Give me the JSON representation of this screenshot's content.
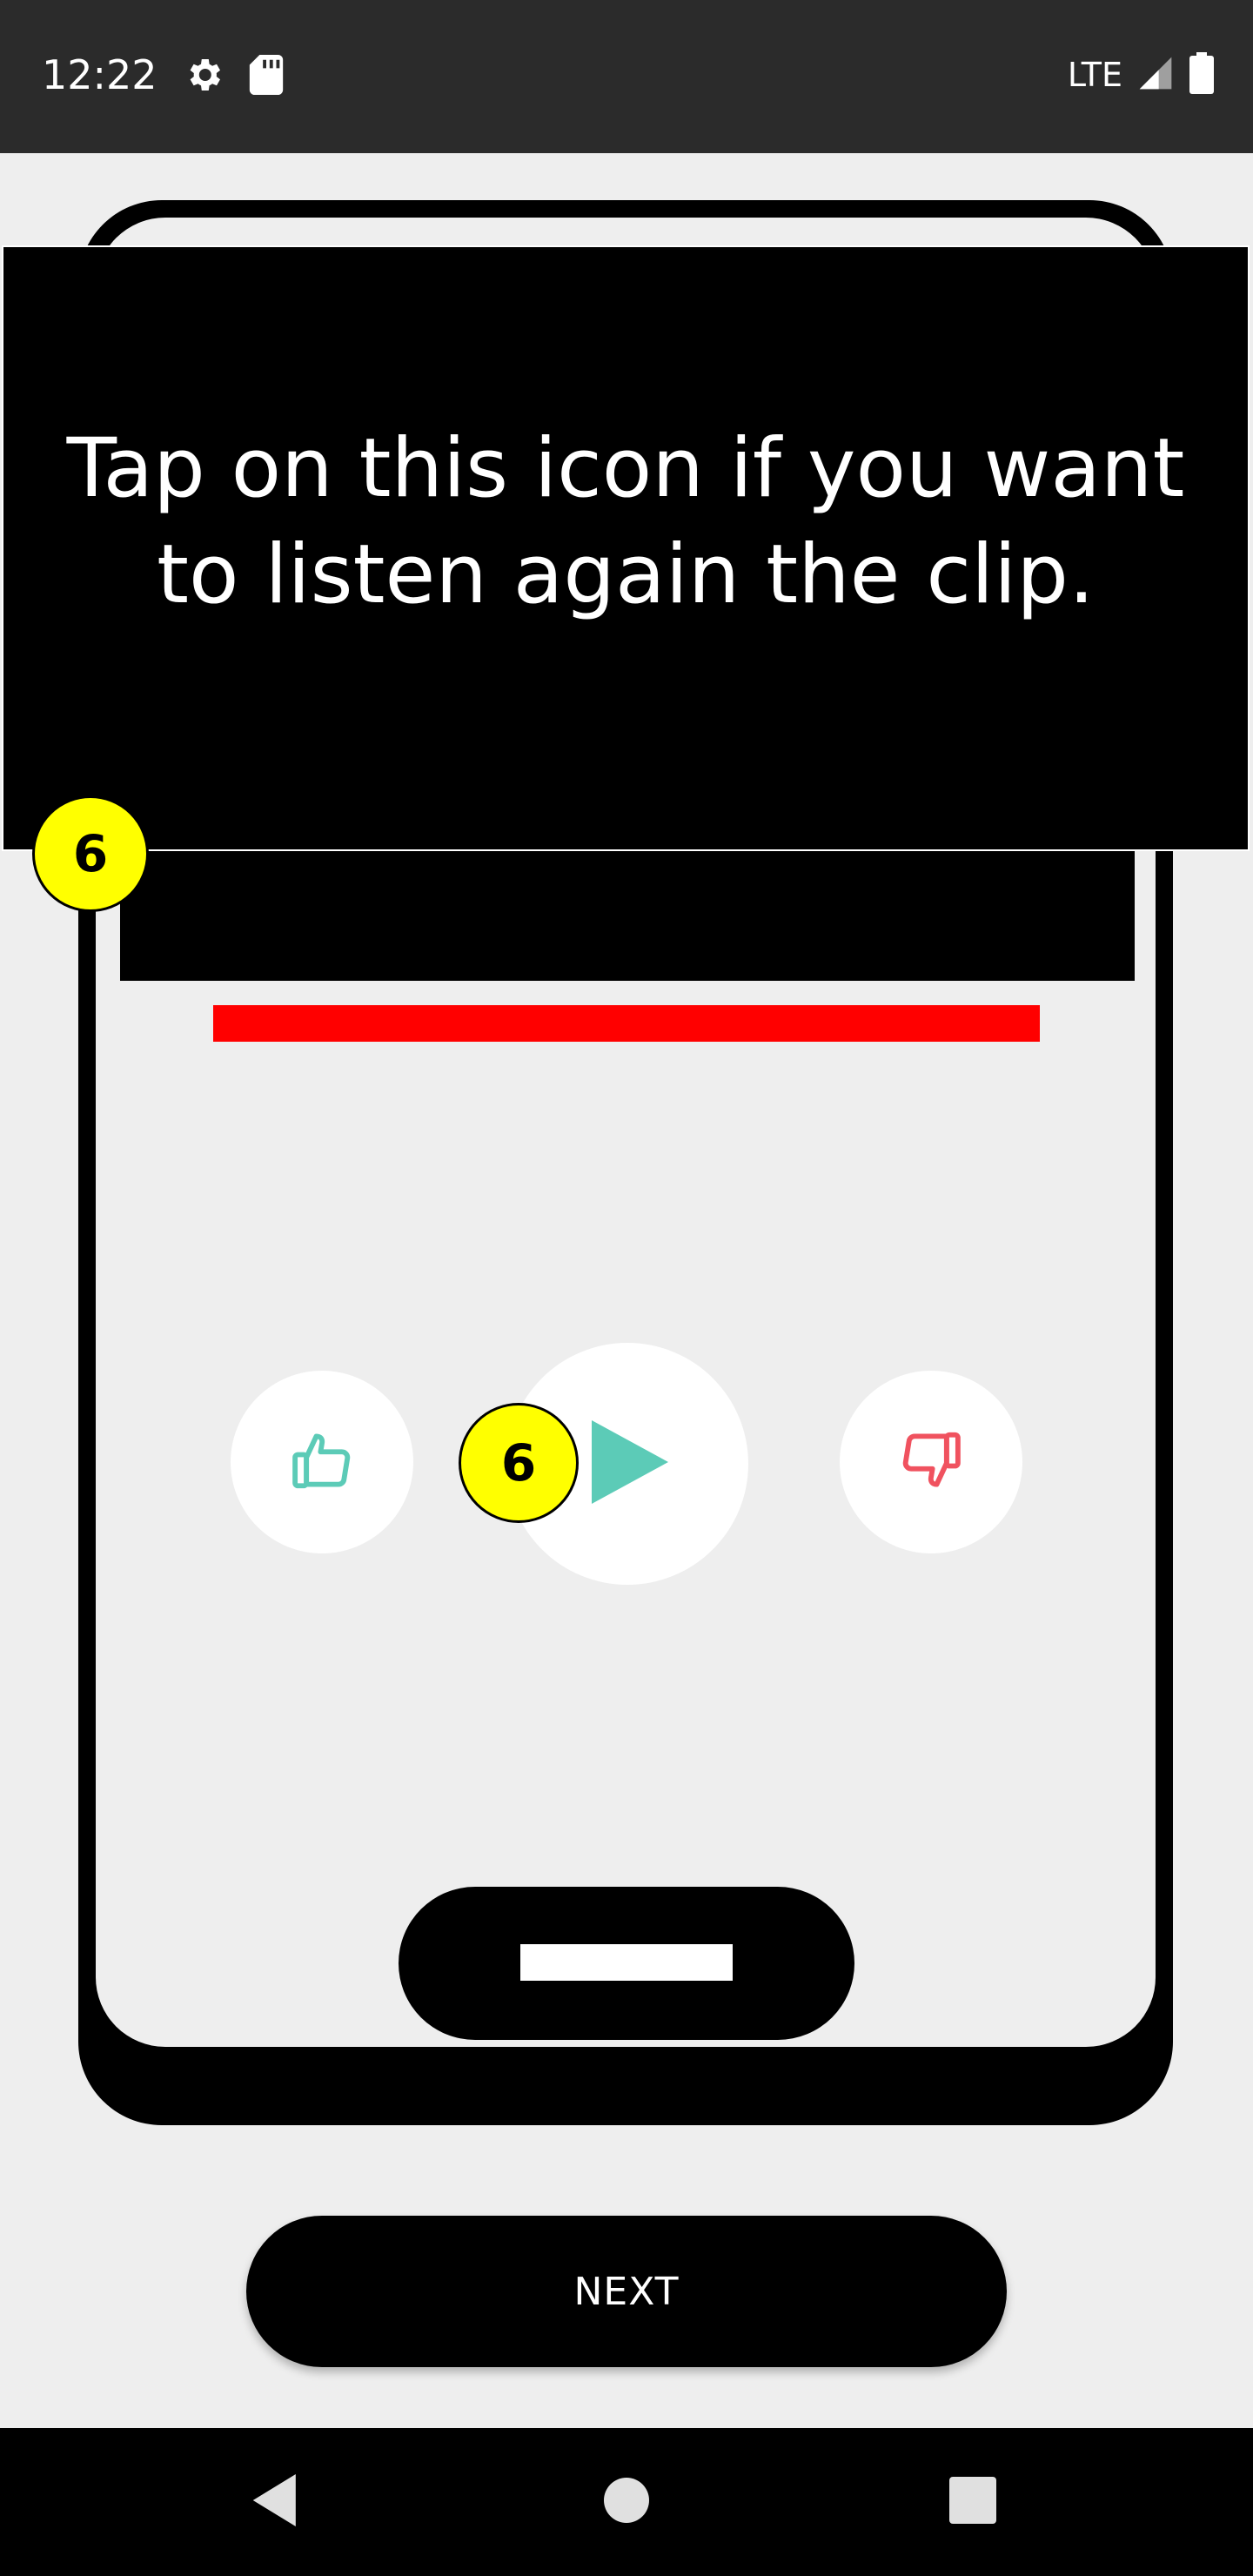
{
  "status_bar": {
    "time": "12:22",
    "network": "LTE",
    "icons": [
      "gear-icon",
      "sd-card-icon",
      "signal-icon",
      "battery-icon"
    ]
  },
  "tutorial": {
    "tooltip_text": "Tap on this icon if you want to listen again the clip.",
    "step_number": "6"
  },
  "clip_controls": {
    "like_icon": "thumbs-up-icon",
    "play_icon": "play-icon",
    "dislike_icon": "thumbs-down-icon",
    "accent_color": "#5ccbb7",
    "dislike_color": "#f0525f",
    "progress_color": "#ff0000"
  },
  "footer": {
    "next_label": "NEXT"
  },
  "nav_bar": {
    "icons": [
      "back-icon",
      "home-icon",
      "recents-icon"
    ]
  }
}
